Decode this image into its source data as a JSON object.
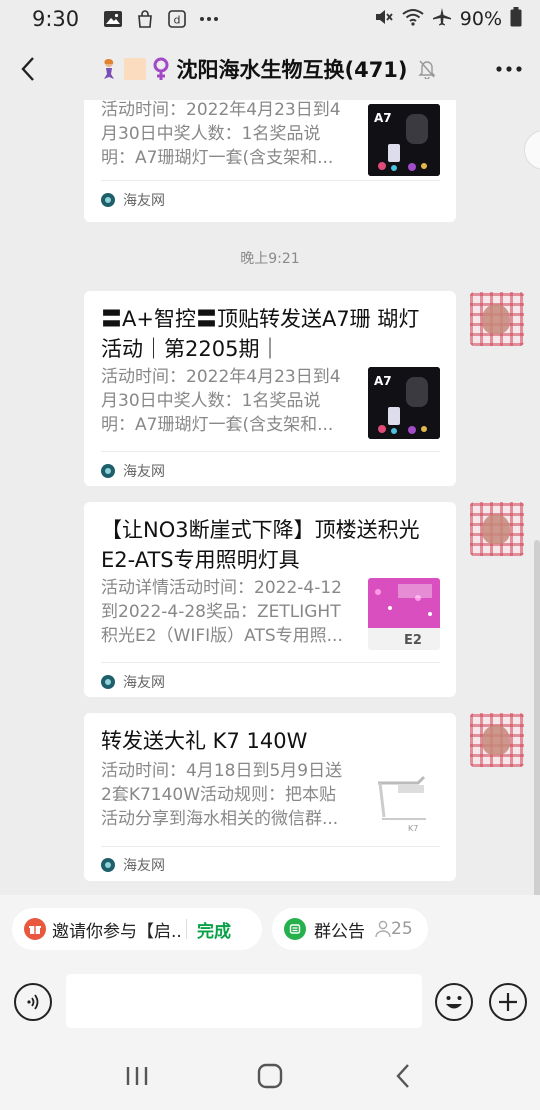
{
  "status_bar": {
    "time": "9:30",
    "icons": [
      "image-icon",
      "bag-icon",
      "d-app-icon",
      "more-dots-icon"
    ],
    "right_icons": [
      "mute-icon",
      "wifi-icon",
      "airplane-icon"
    ],
    "battery": "90%"
  },
  "header": {
    "title": "沈阳海水生物互换(471)",
    "title_emojis": [
      "mermaid-emoji",
      "peach-square-emoji",
      "female-sign-emoji"
    ],
    "muted": true
  },
  "chat": {
    "messages": [
      {
        "title": "",
        "description": "活动时间：2022年4月23日到4月30日中奖人数：1名奖品说明：A7珊瑚灯一套(含支架和...",
        "source": "海友网",
        "thumb_text": "A7"
      },
      {
        "title": "〓A+智控〓顶贴转发送A7珊 瑚灯活动｜第2205期｜",
        "description": "活动时间：2022年4月23日到4月30日中奖人数：1名奖品说明：A7珊瑚灯一套(含支架和...",
        "source": "海友网",
        "thumb_text": "A7"
      },
      {
        "title": "【让NO3断崖式下降】顶楼送积光E2-ATS专用照明灯具",
        "description": "活动详情活动时间：2022-4-12到2022-4-28奖品：ZETLIGHT积光E2（WIFI版）ATS专用照...",
        "source": "海友网",
        "thumb_text": "E2"
      },
      {
        "title": "转发送大礼 K7 140W",
        "description": "活动时间：4月18日到5月9日送2套K7140W活动规则：把本贴活动分享到海水相关的微信群...",
        "source": "海友网",
        "thumb_text": "K7"
      }
    ],
    "time_separator": "晚上9:21"
  },
  "pinned": {
    "invite_text": "邀请你参与【启...",
    "done_label": "完成",
    "notice_label": "群公告",
    "notice_count": "25"
  },
  "input": {
    "value": "",
    "placeholder": ""
  },
  "colors": {
    "background": "#ededed",
    "card": "#ffffff",
    "accent_green": "#07a146",
    "muted_text": "#888888"
  }
}
